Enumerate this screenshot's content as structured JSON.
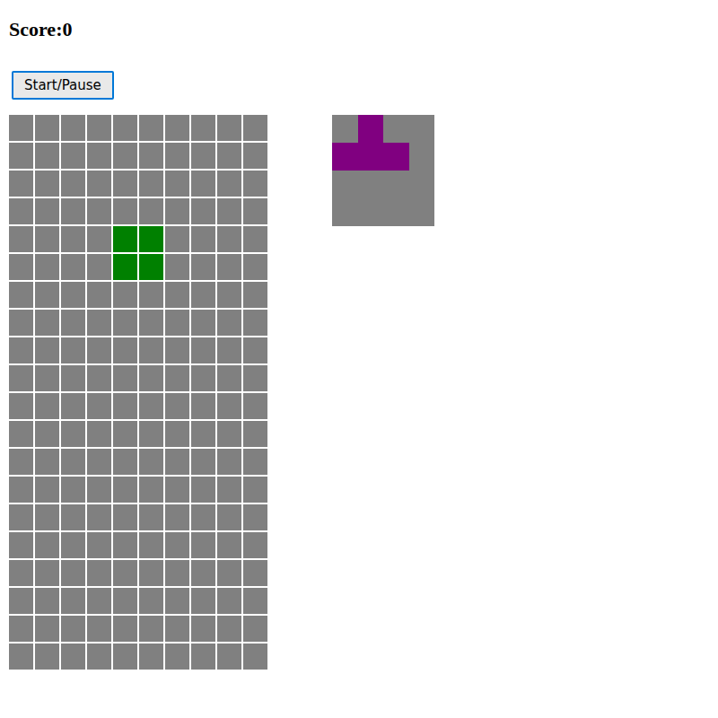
{
  "score": {
    "label": "Score:",
    "value": "0"
  },
  "button": {
    "label": "Start/Pause"
  },
  "board": {
    "rows": [
      [
        "",
        "",
        "",
        "",
        "",
        "",
        "",
        "",
        "",
        ""
      ],
      [
        "",
        "",
        "",
        "",
        "",
        "",
        "",
        "",
        "",
        ""
      ],
      [
        "",
        "",
        "",
        "",
        "",
        "",
        "",
        "",
        "",
        ""
      ],
      [
        "",
        "",
        "",
        "",
        "",
        "",
        "",
        "",
        "",
        ""
      ],
      [
        "",
        "",
        "",
        "",
        "#008000",
        "#008000",
        "",
        "",
        "",
        ""
      ],
      [
        "",
        "",
        "",
        "",
        "#008000",
        "#008000",
        "",
        "",
        "",
        ""
      ],
      [
        "",
        "",
        "",
        "",
        "",
        "",
        "",
        "",
        "",
        ""
      ],
      [
        "",
        "",
        "",
        "",
        "",
        "",
        "",
        "",
        "",
        ""
      ],
      [
        "",
        "",
        "",
        "",
        "",
        "",
        "",
        "",
        "",
        ""
      ],
      [
        "",
        "",
        "",
        "",
        "",
        "",
        "",
        "",
        "",
        ""
      ],
      [
        "",
        "",
        "",
        "",
        "",
        "",
        "",
        "",
        "",
        ""
      ],
      [
        "",
        "",
        "",
        "",
        "",
        "",
        "",
        "",
        "",
        ""
      ],
      [
        "",
        "",
        "",
        "",
        "",
        "",
        "",
        "",
        "",
        ""
      ],
      [
        "",
        "",
        "",
        "",
        "",
        "",
        "",
        "",
        "",
        ""
      ],
      [
        "",
        "",
        "",
        "",
        "",
        "",
        "",
        "",
        "",
        ""
      ],
      [
        "",
        "",
        "",
        "",
        "",
        "",
        "",
        "",
        "",
        ""
      ],
      [
        "",
        "",
        "",
        "",
        "",
        "",
        "",
        "",
        "",
        ""
      ],
      [
        "",
        "",
        "",
        "",
        "",
        "",
        "",
        "",
        "",
        ""
      ],
      [
        "",
        "",
        "",
        "",
        "",
        "",
        "",
        "",
        "",
        ""
      ],
      [
        "",
        "",
        "",
        "",
        "",
        "",
        "",
        "",
        "",
        ""
      ]
    ]
  },
  "next": {
    "rows": [
      [
        "",
        "#800080",
        "",
        ""
      ],
      [
        "#800080",
        "#800080",
        "#800080",
        ""
      ],
      [
        "",
        "",
        "",
        ""
      ],
      [
        "",
        "",
        "",
        ""
      ]
    ]
  }
}
